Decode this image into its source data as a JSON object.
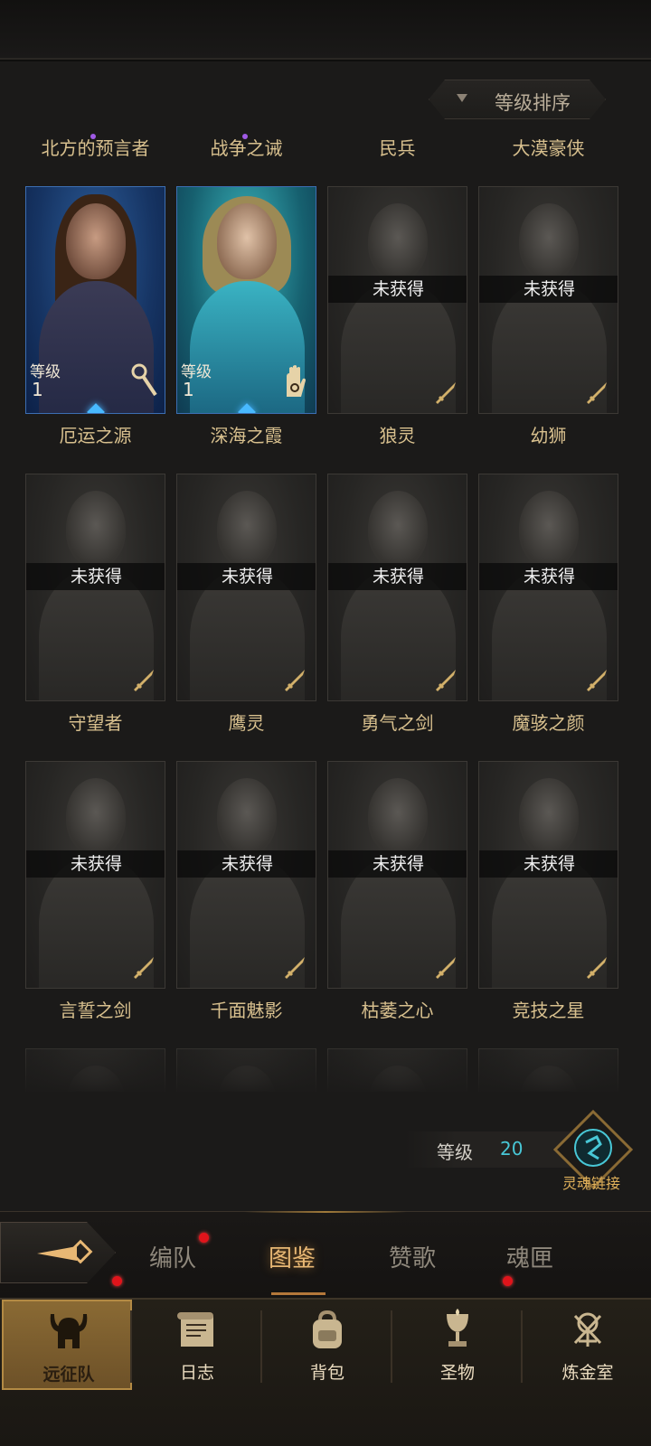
{
  "sort": {
    "label": "等级排序"
  },
  "status_text": "未获得",
  "level_label": "等级",
  "heroes": [
    {
      "name": "北方的预言者",
      "owned": true,
      "level": "1",
      "style": "owned-blue",
      "class_icon": "scepter-icon",
      "new": true
    },
    {
      "name": "战争之诫",
      "owned": true,
      "level": "1",
      "style": "owned-teal",
      "class_icon": "hand-icon",
      "new": true
    },
    {
      "name": "民兵",
      "owned": false,
      "class_icon": "sword-icon"
    },
    {
      "name": "大漠豪侠",
      "owned": false,
      "class_icon": "sword-icon"
    },
    {
      "name": "厄运之源",
      "owned": false,
      "class_icon": "sword-icon"
    },
    {
      "name": "深海之霞",
      "owned": false,
      "class_icon": "sword-icon"
    },
    {
      "name": "狼灵",
      "owned": false,
      "class_icon": "sword-icon"
    },
    {
      "name": "幼狮",
      "owned": false,
      "class_icon": "sword-icon"
    },
    {
      "name": "守望者",
      "owned": false,
      "class_icon": "sword-icon"
    },
    {
      "name": "鹰灵",
      "owned": false,
      "class_icon": "sword-icon"
    },
    {
      "name": "勇气之剑",
      "owned": false,
      "class_icon": "sword-icon"
    },
    {
      "name": "魔骇之颜",
      "owned": false,
      "class_icon": "sword-icon"
    },
    {
      "name": "言誓之剑",
      "owned": false,
      "class_icon": "sword-icon"
    },
    {
      "name": "千面魅影",
      "owned": false,
      "class_icon": "sword-icon"
    },
    {
      "name": "枯萎之心",
      "owned": false,
      "class_icon": "sword-icon"
    },
    {
      "name": "竞技之星",
      "owned": false,
      "class_icon": "sword-icon"
    }
  ],
  "soul_link": {
    "level_label": "等级",
    "level_value": "20",
    "button_label": "灵魂链接"
  },
  "tabs": [
    {
      "label": "编队",
      "active": false,
      "badge": true
    },
    {
      "label": "图鉴",
      "active": true,
      "badge": false
    },
    {
      "label": "赞歌",
      "active": false,
      "badge": false
    },
    {
      "label": "魂匣",
      "active": false,
      "badge": false
    }
  ],
  "nav": [
    {
      "label": "远征队",
      "icon": "horned-helmet-icon",
      "active": true,
      "badge": true
    },
    {
      "label": "日志",
      "icon": "scroll-icon",
      "active": false,
      "badge": false
    },
    {
      "label": "背包",
      "icon": "backpack-icon",
      "active": false,
      "badge": false
    },
    {
      "label": "圣物",
      "icon": "chalice-icon",
      "active": false,
      "badge": true
    },
    {
      "label": "炼金室",
      "icon": "alchemy-icon",
      "active": false,
      "badge": false
    }
  ],
  "colors": {
    "accent": "#d8c08e",
    "active_tab": "#e8b874",
    "badge": "#e0141b",
    "level_value": "#48c7d6"
  }
}
